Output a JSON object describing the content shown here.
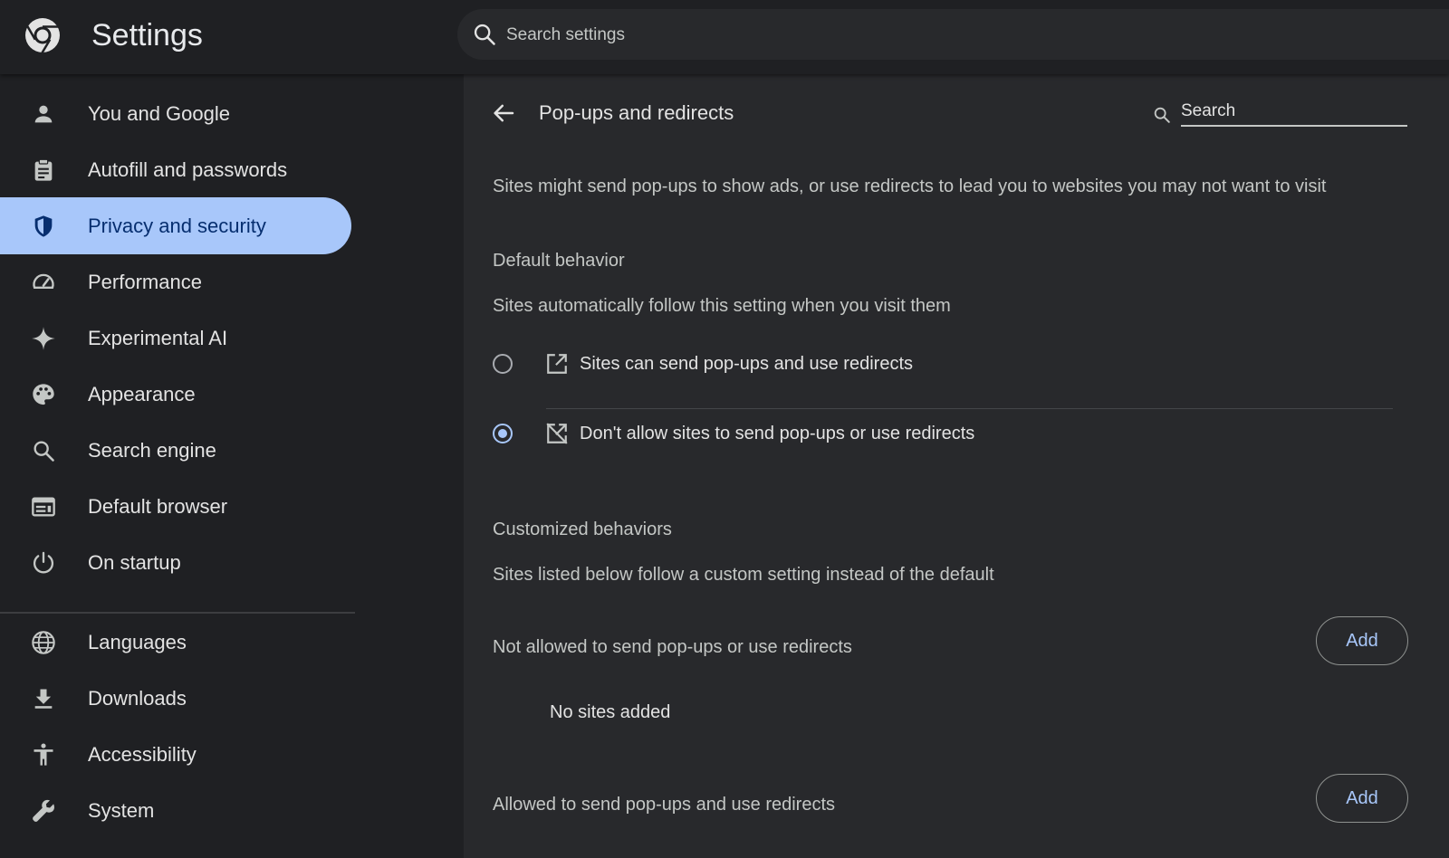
{
  "header": {
    "app_title": "Settings",
    "search_placeholder": "Search settings"
  },
  "sidebar": {
    "items": [
      {
        "label": "You and Google",
        "icon": "person-icon"
      },
      {
        "label": "Autofill and passwords",
        "icon": "clipboard-icon"
      },
      {
        "label": "Privacy and security",
        "icon": "shield-icon",
        "active": true
      },
      {
        "label": "Performance",
        "icon": "speedometer-icon"
      },
      {
        "label": "Experimental AI",
        "icon": "sparkle-icon"
      },
      {
        "label": "Appearance",
        "icon": "palette-icon"
      },
      {
        "label": "Search engine",
        "icon": "search-icon"
      },
      {
        "label": "Default browser",
        "icon": "browser-window-icon"
      },
      {
        "label": "On startup",
        "icon": "power-icon"
      },
      {
        "label": "Languages",
        "icon": "globe-icon"
      },
      {
        "label": "Downloads",
        "icon": "download-icon"
      },
      {
        "label": "Accessibility",
        "icon": "accessibility-icon"
      },
      {
        "label": "System",
        "icon": "wrench-icon"
      }
    ]
  },
  "main": {
    "title": "Pop-ups and redirects",
    "search_placeholder": "Search",
    "description": "Sites might send pop-ups to show ads, or use redirects to lead you to websites you may not want to visit",
    "default_behavior": {
      "heading": "Default behavior",
      "subtext": "Sites automatically follow this setting when you visit them",
      "options": [
        {
          "label": "Sites can send pop-ups and use redirects",
          "icon": "open-in-new-icon",
          "checked": false
        },
        {
          "label": "Don't allow sites to send pop-ups or use redirects",
          "icon": "blocked-popup-icon",
          "checked": true
        }
      ]
    },
    "customized": {
      "heading": "Customized behaviors",
      "subtext": "Sites listed below follow a custom setting instead of the default",
      "not_allowed_label": "Not allowed to send pop-ups or use redirects",
      "not_allowed_empty": "No sites added",
      "allowed_label": "Allowed to send pop-ups and use redirects",
      "add_label": "Add"
    }
  },
  "colors": {
    "accent": "#a8c7fa",
    "active_text": "#062e6f",
    "background": "#1f2023",
    "panel": "#28292c"
  }
}
